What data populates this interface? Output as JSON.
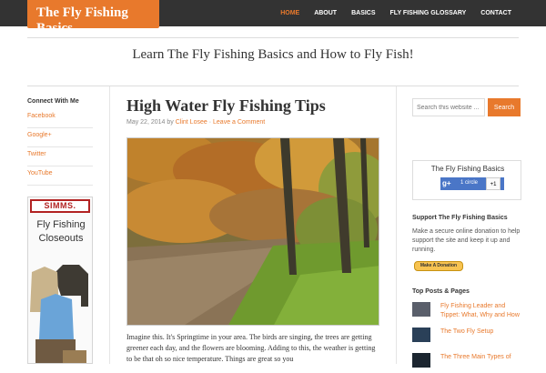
{
  "site": {
    "logo_text": "The Fly Fishing Basics",
    "tagline": "Learn The Fly Fishing Basics and How to Fly Fish!"
  },
  "nav": {
    "items": [
      {
        "label": "HOME",
        "active": true
      },
      {
        "label": "ABOUT"
      },
      {
        "label": "BASICS"
      },
      {
        "label": "FLY FISHING GLOSSARY"
      },
      {
        "label": "CONTACT"
      }
    ]
  },
  "left_sidebar": {
    "title": "Connect With Me",
    "links": [
      "Facebook",
      "Google+",
      "Twitter",
      "YouTube"
    ],
    "ad": {
      "brand": "SIMMS.",
      "text": "Fly Fishing Closeouts"
    }
  },
  "post": {
    "title": "High Water Fly Fishing Tips",
    "date": "May 22, 2014",
    "by": "by",
    "author": "Clint Losee",
    "separator": "·",
    "comment_link": "Leave a Comment",
    "body": "Imagine this. It's Springtime in your area. The birds are singing, the trees are getting greener each day, and the flowers are blooming. Adding to this, the weather is getting to be that oh so nice temperature. Things are great so you"
  },
  "right_sidebar": {
    "search": {
      "placeholder": "Search this website ...",
      "button": "Search"
    },
    "gplus": {
      "title": "The Fly Fishing Basics",
      "g_label": "g+",
      "circle_label": "1 circle",
      "count": "+1"
    },
    "support": {
      "title": "Support The Fly Fishing Basics",
      "text": "Make a secure online donation to help support the site and keep it up and running.",
      "donate_label": "Make A Donation"
    },
    "top_posts": {
      "title": "Top Posts & Pages",
      "items": [
        "Fly Fishing Leader and Tippet: What, Why and How",
        "The Two Fly Setup",
        "The Three Main Types of"
      ]
    }
  },
  "colors": {
    "accent": "#e8792c",
    "topbar": "#333333"
  }
}
